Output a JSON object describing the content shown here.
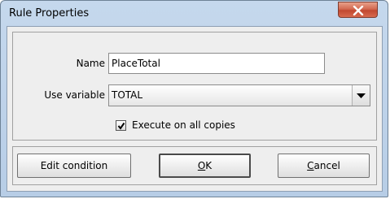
{
  "window": {
    "title": "Rule Properties"
  },
  "form": {
    "name_label": "Name",
    "name_value": "PlaceTotal",
    "variable_label": "Use variable",
    "variable_value": "TOTAL",
    "execute_all_label": "Execute on all copies",
    "execute_all_checked": true
  },
  "buttons": {
    "edit_condition": "Edit condition",
    "ok_mnemonic": "O",
    "ok_rest": "K",
    "cancel_mnemonic": "C",
    "cancel_rest": "ancel"
  },
  "icons": {
    "close": "close-icon",
    "dropdown": "chevron-down-icon",
    "check": "check-icon"
  },
  "colors": {
    "titlebar": "#c5d8ed",
    "close_button": "#c94f36",
    "dialog_background": "#eeeeee"
  }
}
